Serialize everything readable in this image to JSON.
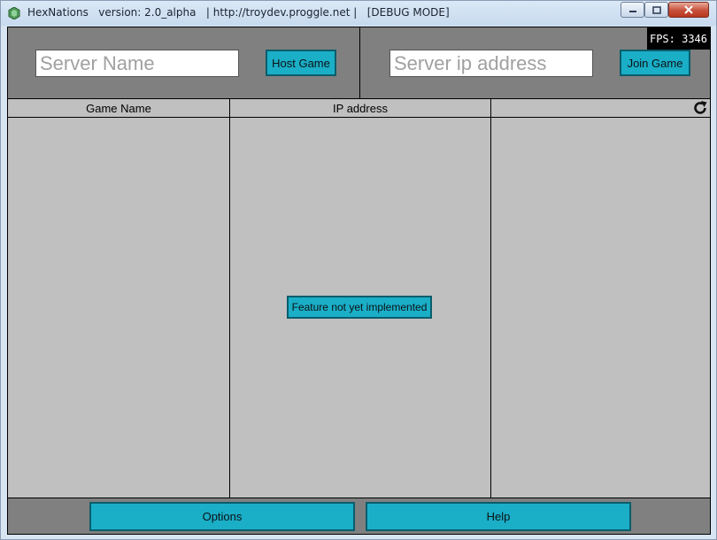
{
  "window": {
    "title": "HexNations   version: 2.0_alpha   | http://troydev.proggle.net |   [DEBUG MODE]"
  },
  "top": {
    "server_name_placeholder": "Server Name",
    "server_name_value": "",
    "host_label": "Host Game",
    "server_ip_placeholder": "Server ip address",
    "server_ip_value": "",
    "join_label": "Join Game",
    "fps": "FPS: 3346"
  },
  "table": {
    "columns": [
      "Game Name",
      "IP address",
      ""
    ],
    "refresh_icon": "refresh-icon",
    "message": "Feature not yet implemented"
  },
  "bottom": {
    "options_label": "Options",
    "help_label": "Help"
  },
  "colors": {
    "button_fill": "#1aaec7",
    "panel_gray": "#808080",
    "list_gray": "#c0c0c0"
  }
}
